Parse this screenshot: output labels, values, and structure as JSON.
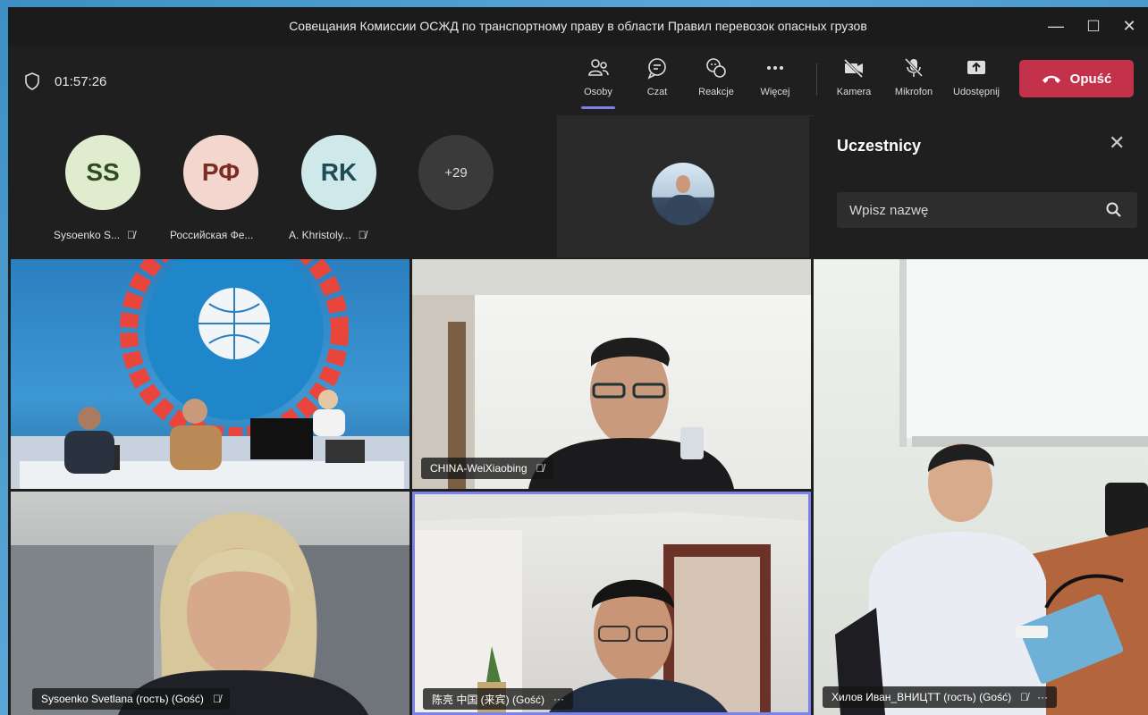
{
  "window": {
    "title": "Совещания Комиссии ОСЖД по транспортному праву в области Правил перевозок опасных грузов",
    "controls": {
      "minimize": "—",
      "maximize": "☐",
      "close": "✕"
    }
  },
  "toolbar": {
    "timer": "01:57:26",
    "buttons": [
      {
        "label": "Osoby",
        "icon": "people-icon",
        "active": true
      },
      {
        "label": "Czat",
        "icon": "chat-icon"
      },
      {
        "label": "Reakcje",
        "icon": "reaction-icon"
      },
      {
        "label": "Więcej",
        "icon": "more-icon"
      },
      {
        "label": "Kamera",
        "icon": "camera-off-icon"
      },
      {
        "label": "Mikrofon",
        "icon": "mic-off-icon"
      },
      {
        "label": "Udostępnij",
        "icon": "share-icon"
      }
    ],
    "leave_label": "Opuść",
    "leave_color": "#c4314b"
  },
  "strip": {
    "participants": [
      {
        "initials": "SS",
        "name": "Sysoenko S...",
        "bg": "#dfeccd",
        "fg": "#2e4a23"
      },
      {
        "initials": "РФ",
        "name": "Российская Фе...",
        "bg": "#f3d7ce",
        "fg": "#7a2d23"
      },
      {
        "initials": "RK",
        "name": "A. Khristoly...",
        "bg": "#cfe8e9",
        "fg": "#1d4c55"
      }
    ],
    "more_count": "+29"
  },
  "panel": {
    "title": "Uczestnicy",
    "search_placeholder": "Wpisz nazwę"
  },
  "videos": [
    {
      "name": "",
      "scene": "conference-room"
    },
    {
      "name": "CHINA-WeiXiaobing",
      "scene": "office"
    },
    {
      "name": "Хилов Иван_ВНИЦТТ (гость) (Gość)",
      "scene": "office-desk"
    },
    {
      "name": "Sysoenko Svetlana (гость) (Gość)",
      "scene": "office"
    },
    {
      "name": "陈亮 中国 (来宾) (Gość)",
      "scene": "office",
      "speaking": true
    }
  ],
  "colors": {
    "accent": "#7b83eb",
    "background": "#1f1f1f"
  }
}
